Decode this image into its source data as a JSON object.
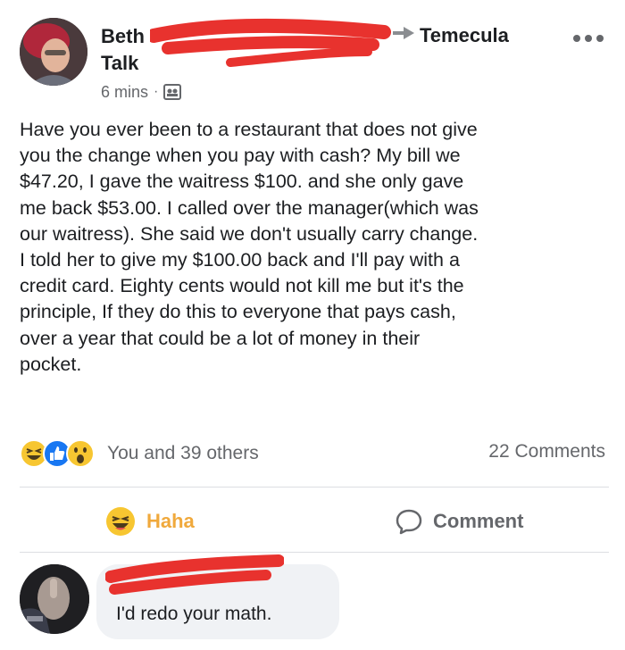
{
  "post": {
    "author": "Beth Talk",
    "group": "Temecula",
    "time": "6 mins",
    "separator": "·",
    "text": "Have you ever been to a restaurant that does not give\nyou the change when you pay with cash? My bill we\n$47.20, I gave the waitress $100. and she only gave\nme back $53.00. I called over the manager(which was\nour waitress). She said we don't usually carry change.\nI told her to give my $100.00 back and I'll pay with a\ncredit card. Eighty cents would not kill me but it's the\nprinciple, If they do this to everyone that pays cash,\nover a year that could be a lot of money in their\npocket.",
    "reactions": {
      "icons": [
        "haha-icon",
        "like-icon",
        "wow-icon"
      ],
      "summary": "You and 39 others",
      "comments": "22 Comments"
    },
    "actions": {
      "haha_label": "Haha",
      "comment_label": "Comment"
    }
  },
  "comment": {
    "text": "I'd redo your math."
  },
  "colors": {
    "text": "#1c1e21",
    "muted": "#65676b",
    "haha": "#f0a93c",
    "redaction": "#e8322e",
    "bubble": "#f0f2f5"
  }
}
